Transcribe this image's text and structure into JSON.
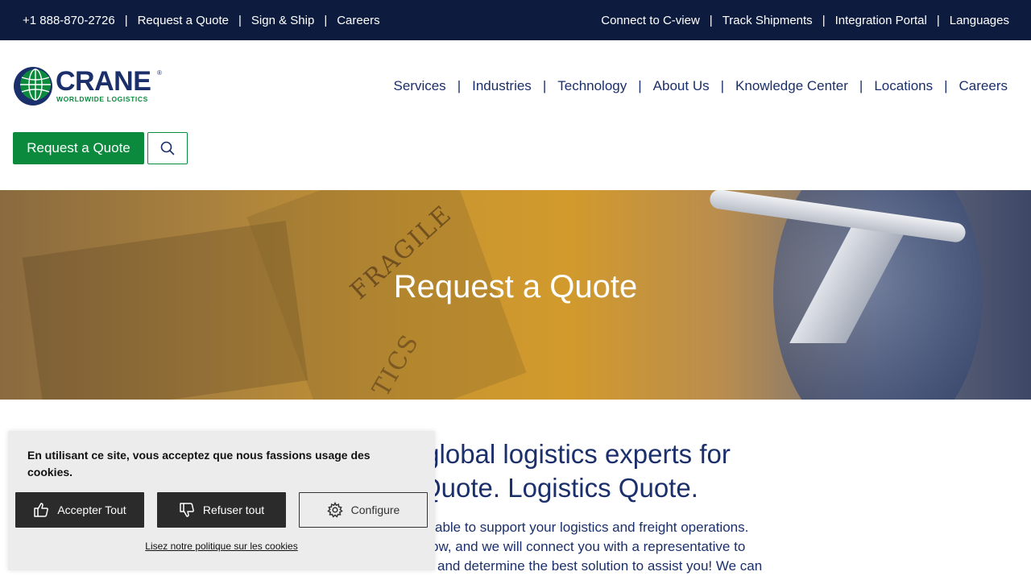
{
  "topbar": {
    "left_links": [
      "+1 888-870-2726",
      "Request a Quote",
      "Sign & Ship",
      "Careers"
    ],
    "right_links": [
      "Connect to C-view",
      "Track Shipments",
      "Integration Portal",
      "Languages"
    ],
    "separator": "|"
  },
  "logo": {
    "word": "CRANE",
    "registered": "®",
    "tagline": "WORLDWIDE LOGISTICS"
  },
  "nav": {
    "items": [
      "Services",
      "Industries",
      "Technology",
      "About Us",
      "Knowledge Center",
      "Locations",
      "Careers"
    ],
    "separator": "|"
  },
  "header_actions": {
    "quote_label": "Request a Quote",
    "search_icon": "search-icon"
  },
  "hero": {
    "title": "Request a Quote",
    "image_text_1": "FRAGILE",
    "image_text_2": "TICS"
  },
  "content": {
    "heading": "r global logistics experts for Quote. Logistics Quote.",
    "heading_line1": "r global logistics experts for",
    "heading_line2": "Quote. Logistics Quote.",
    "body_line1": "able to support your logistics and freight operations.",
    "body_line2": "ow, and we will connect you with a representative to",
    "body_line3": "and determine the best solution to assist you! We can"
  },
  "cookie": {
    "message": "En utilisant ce site, vous acceptez que nous fassions usage des cookies.",
    "accept_label": "Accepter Tout",
    "refuse_label": "Refuser tout",
    "configure_label": "Configure",
    "policy_link": "Lisez notre politique sur les cookies"
  },
  "colors": {
    "topbar_bg": "#0d1b3e",
    "brand_navy": "#1b2f6b",
    "brand_green": "#0b8a3e",
    "cookie_bg": "#ececec",
    "cookie_dark_button": "#2b2b2b"
  }
}
